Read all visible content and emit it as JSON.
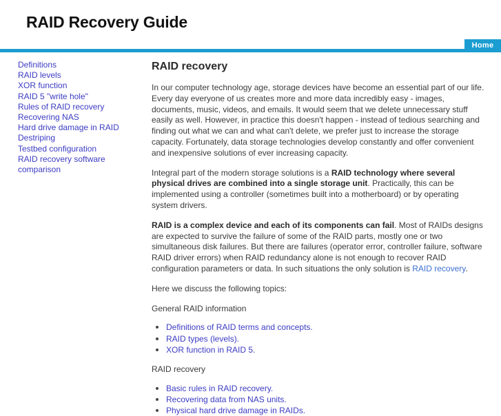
{
  "header": {
    "title": "RAID Recovery Guide",
    "nav": [
      {
        "label": "Home"
      }
    ],
    "accent_color": "#1b9dd1"
  },
  "sidebar": {
    "items": [
      {
        "label": "Definitions"
      },
      {
        "label": "RAID levels"
      },
      {
        "label": "XOR function"
      },
      {
        "label": "RAID 5 \"write hole\""
      },
      {
        "label": "Rules of RAID recovery"
      },
      {
        "label": "Recovering NAS"
      },
      {
        "label": "Hard drive damage in RAID"
      },
      {
        "label": "Destriping"
      },
      {
        "label": "Testbed configuration"
      },
      {
        "label": "RAID recovery software comparison"
      }
    ],
    "link_color": "#3b3bc4"
  },
  "content": {
    "heading": "RAID recovery",
    "paragraph1": "In our computer technology age, storage devices have become an essential part of our life. Every day everyone of us creates more and more data incredibly easy - images, documents, music, videos, and emails. It would seem that we delete unnecessary stuff easily as well. However, in practice this doesn't happen - instead of tedious searching and finding out what we can and what can't delete, we prefer just to increase the storage capacity. Fortunately, data storage technologies develop constantly and offer convenient and inexpensive solutions of ever increasing capacity.",
    "paragraph2": {
      "lead": "Integral part of the modern storage solutions is a ",
      "bold": "RAID technology where several physical drives are combined into a single storage unit",
      "tail": ". Practically, this can be implemented using a controller (sometimes built into a motherboard) or by operating system drivers."
    },
    "paragraph3": {
      "bold": "RAID is a complex device and each of its components can fail",
      "mid": ". Most of RAIDs designs are expected to survive the failure of some of the RAID parts, mostly one or two simultaneous disk failures. But there are failures (operator error, controller failure, software RAID driver errors) when RAID redundancy alone is not enough to recover RAID configuration parameters or data. In such situations the only solution is ",
      "link": "RAID recovery",
      "tail": "."
    },
    "topics_intro": "Here we discuss the following topics:",
    "section1": {
      "label": "General RAID information",
      "items": [
        {
          "label": "Definitions of RAID terms and concepts."
        },
        {
          "label": "RAID types (levels)."
        },
        {
          "label": "XOR function in RAID 5."
        }
      ]
    },
    "section2": {
      "label": "RAID recovery",
      "items": [
        {
          "label": "Basic rules in RAID recovery."
        },
        {
          "label": "Recovering data from NAS units."
        },
        {
          "label": "Physical hard drive damage in RAIDs."
        }
      ]
    }
  }
}
